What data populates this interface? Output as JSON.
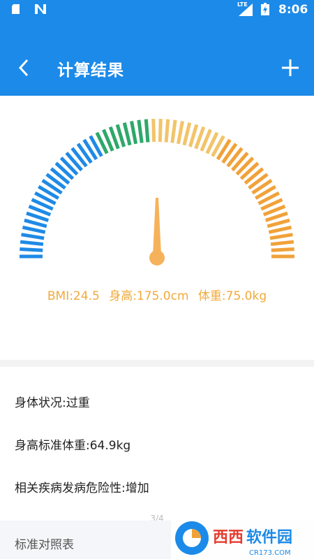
{
  "status_bar": {
    "network_label": "LTE",
    "time": "8:06",
    "icons": [
      "sd-card-icon",
      "notification-n-icon",
      "signal-icon",
      "battery-charging-icon"
    ]
  },
  "app_bar": {
    "title": "计算结果",
    "back_icon": "back-chevron-icon",
    "add_icon": "plus-icon"
  },
  "gauge": {
    "colors": {
      "blue": "#1f8ae6",
      "green": "#2ea86a",
      "yellow": "#f2c46a",
      "orange": "#f0a23a"
    },
    "needle_color": "#f6b25a"
  },
  "readout": {
    "bmi": "BMI:24.5",
    "height": "身高:175.0cm",
    "weight": "体重:75.0kg"
  },
  "results": {
    "body_status": "身体状况:过重",
    "standard_weight": "身高标准体重:64.9kg",
    "risk": "相关疾病发病危险性:增加"
  },
  "pager": {
    "indicator": "3/4"
  },
  "next_card": {
    "title": "标准对照表"
  },
  "watermark": {
    "brand": "西西软件园",
    "url": "CR173.COM"
  },
  "colors": {
    "primary": "#1c8ae8",
    "accent": "#f1a93a"
  }
}
